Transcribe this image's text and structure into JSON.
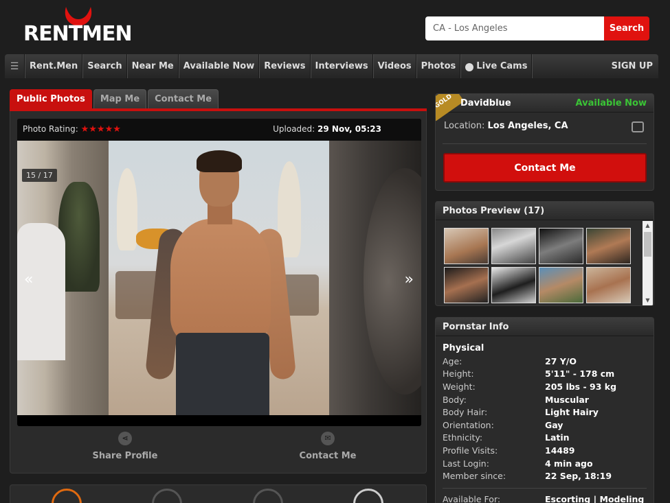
{
  "header": {
    "logo_text": "RENTMEN",
    "search": {
      "value": "CA - Los Angeles",
      "button_label": "Search"
    }
  },
  "nav": {
    "items": [
      "Rent.Men",
      "Search",
      "Near Me",
      "Available Now",
      "Reviews",
      "Interviews",
      "Videos",
      "Photos",
      "Live Cams"
    ],
    "signup": "SIGN UP"
  },
  "tabs": [
    "Public Photos",
    "Map Me",
    "Contact Me"
  ],
  "photo": {
    "rating_label": "Photo Rating:",
    "stars": "★★★★★",
    "uploaded_label": "Uploaded:",
    "uploaded_value": "29 Nov, 05:23",
    "counter": "15 / 17",
    "prev": "«",
    "next": "»"
  },
  "actions": {
    "share": "Share Profile",
    "contact": "Contact Me"
  },
  "profile": {
    "badge": "GOLD",
    "name": "Davidblue",
    "status": "Available Now",
    "location_label": "Location:",
    "location_value": "Los Angeles, CA",
    "contact_button": "Contact Me"
  },
  "preview": {
    "title": "Photos Preview (17)"
  },
  "info": {
    "title": "Pornstar Info",
    "section": "Physical",
    "rows": [
      {
        "label": "Age:",
        "value": "27 Y/O"
      },
      {
        "label": "Height:",
        "value": "5'11\" - 178 cm"
      },
      {
        "label": "Weight:",
        "value": "205 lbs - 93 kg"
      },
      {
        "label": "Body:",
        "value": "Muscular"
      },
      {
        "label": "Body Hair:",
        "value": "Light Hairy"
      },
      {
        "label": "Orientation:",
        "value": "Gay"
      },
      {
        "label": "Ethnicity:",
        "value": "Latin"
      },
      {
        "label": "Profile Visits:",
        "value": "14489"
      },
      {
        "label": "Last Login:",
        "value": "4 min ago"
      },
      {
        "label": "Member since:",
        "value": "22 Sep, 18:19"
      }
    ],
    "available_for_label": "Available For:",
    "available_for_value": "Escorting | Modeling"
  },
  "colors": {
    "accent_red": "#e0120f",
    "available_green": "#3ac435",
    "gold_badge": "#b88b24"
  }
}
